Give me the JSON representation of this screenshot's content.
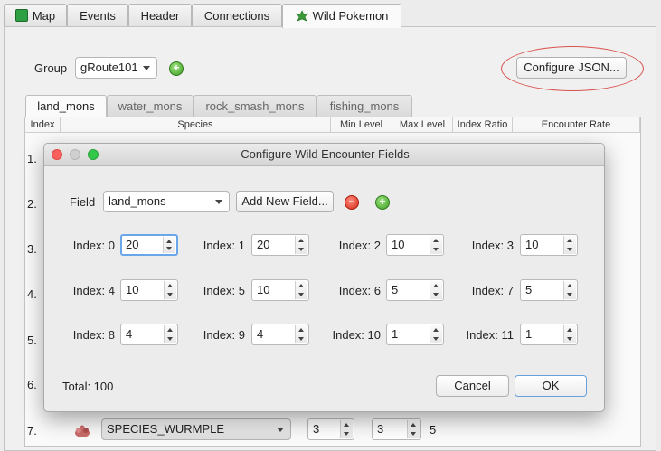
{
  "main_tabs": [
    {
      "label": "Map",
      "active": false
    },
    {
      "label": "Events",
      "active": false
    },
    {
      "label": "Header",
      "active": false
    },
    {
      "label": "Connections",
      "active": false
    },
    {
      "label": "Wild Pokemon",
      "active": true
    }
  ],
  "group": {
    "label": "Group",
    "value": "gRoute101"
  },
  "configure_json_label": "Configure JSON...",
  "sub_tabs": [
    {
      "label": "land_mons",
      "active": true
    },
    {
      "label": "water_mons",
      "active": false
    },
    {
      "label": "rock_smash_mons",
      "active": false
    },
    {
      "label": "fishing_mons",
      "active": false
    }
  ],
  "table_headers": [
    "Index",
    "Species",
    "Min Level",
    "Max Level",
    "Index Ratio",
    "Encounter Rate"
  ],
  "row_numbers": [
    "1.",
    "2.",
    "3.",
    "4.",
    "5.",
    "6.",
    "7."
  ],
  "visible_row": {
    "species": "SPECIES_WURMPLE",
    "min_level": "3",
    "max_level": "3",
    "ratio": "5"
  },
  "dialog": {
    "title": "Configure Wild Encounter Fields",
    "field_label": "Field",
    "field_value": "land_mons",
    "add_field_label": "Add New Field...",
    "indexes": [
      {
        "label": "Index: 0",
        "value": "20"
      },
      {
        "label": "Index: 1",
        "value": "20"
      },
      {
        "label": "Index: 2",
        "value": "10"
      },
      {
        "label": "Index: 3",
        "value": "10"
      },
      {
        "label": "Index: 4",
        "value": "10"
      },
      {
        "label": "Index: 5",
        "value": "10"
      },
      {
        "label": "Index: 6",
        "value": "5"
      },
      {
        "label": "Index: 7",
        "value": "5"
      },
      {
        "label": "Index: 8",
        "value": "4"
      },
      {
        "label": "Index: 9",
        "value": "4"
      },
      {
        "label": "Index: 10",
        "value": "1"
      },
      {
        "label": "Index: 11",
        "value": "1"
      }
    ],
    "total_label": "Total: 100",
    "cancel_label": "Cancel",
    "ok_label": "OK"
  },
  "colors": {
    "annotation": "#d9534f",
    "focus": "#6aa6ea",
    "add_icon": "#3f9d24",
    "remove_icon": "#d62b1a"
  }
}
